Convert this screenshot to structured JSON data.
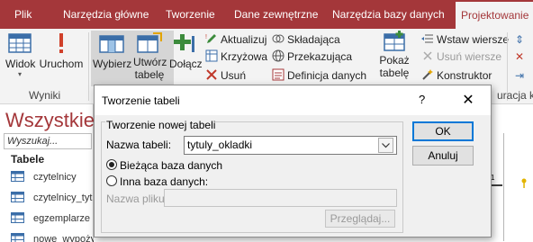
{
  "ribbon_tabs": [
    "Plik",
    "Narzędzia główne",
    "Tworzenie",
    "Dane zewnętrzne",
    "Narzędzia bazy danych",
    "Projektowanie"
  ],
  "ribbon": {
    "view_label": "Widok",
    "run_label": "Uruchom",
    "select_label": "Wybierz",
    "make_table_label": "Utwórz",
    "make_table_label2": "tabelę",
    "append_label": "Dołącz",
    "update_label": "Aktualizuj",
    "crosstab_label": "Krzyżowa",
    "delete_label": "Usuń",
    "union_label": "Składająca",
    "passthrough_label": "Przekazująca",
    "data_def_label": "Definicja danych",
    "show_table_label": "Pokaż",
    "show_table_label2": "tabelę",
    "insert_rows_label": "Wstaw wiersze",
    "delete_rows_label": "Usuń wiersze",
    "builder_label": "Konstruktor",
    "results_group": "Wyniki",
    "setup_group_partial": "uracja kwer"
  },
  "nav": {
    "title": "Wszystkie o",
    "search_placeholder": "Wyszukaj...",
    "section": "Tabele",
    "items": [
      "czytelnicy",
      "czytelnicy_tyt",
      "egzemplarze",
      "nowe_wypożyczenia"
    ]
  },
  "dialog": {
    "title": "Tworzenie tabeli",
    "help_glyph": "?",
    "close_glyph": "✕",
    "group_legend": "Tworzenie nowej tabeli",
    "table_name_label": "Nazwa tabeli:",
    "table_name_value": "tytuly_okladki",
    "current_db_label": "Bieżąca baza danych",
    "other_db_label": "Inna baza danych:",
    "file_name_label": "Nazwa pliku:",
    "browse_label": "Przeglądaj...",
    "ok_label": "OK",
    "cancel_label": "Anuluj"
  },
  "colors": {
    "brand": "#a4373a",
    "focus": "#0078d7"
  }
}
